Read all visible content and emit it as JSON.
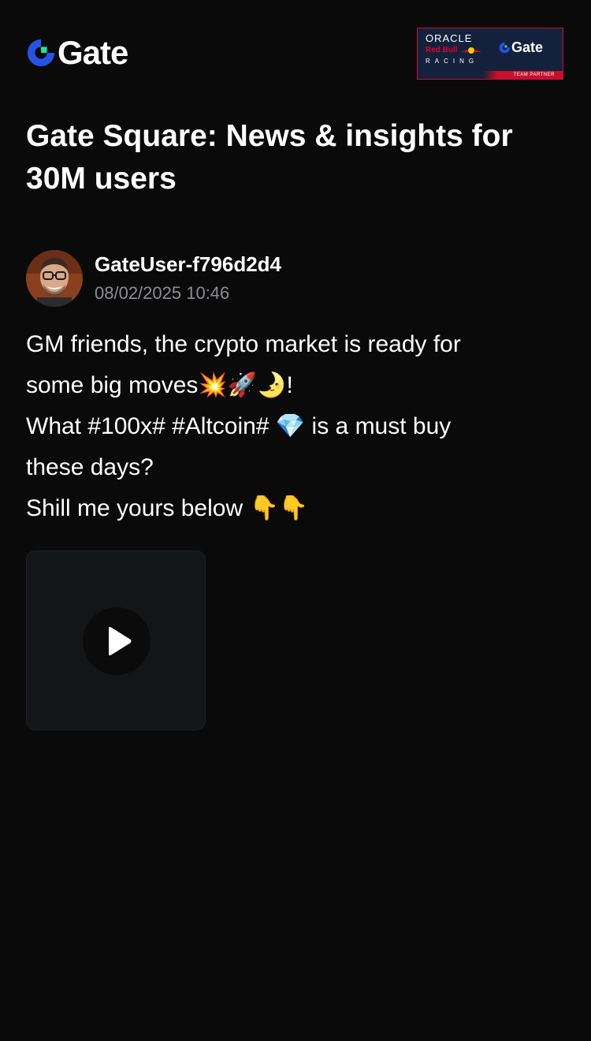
{
  "header": {
    "logo_text": "Gate",
    "brand_color": "#2354e6",
    "accent_color": "#17e6a1",
    "partner_badge": {
      "oracle": "ORACLE",
      "redbull": "Red Bull",
      "racing": "RACING",
      "gate": "Gate",
      "strip": "TEAM PARTNER"
    }
  },
  "page": {
    "title": "Gate Square: News & insights for 30M users"
  },
  "post": {
    "author": {
      "username": "GateUser-f796d2d4",
      "timestamp": "08/02/2025 10:46"
    },
    "lines": [
      "GM friends, the crypto market is ready for",
      "some big moves💥🚀🌛!",
      "What #100x# #Altcoin# 💎 is a must buy",
      "these days?",
      "Shill me yours below 👇👇"
    ],
    "media": {
      "type": "video",
      "icon": "play-icon"
    }
  }
}
